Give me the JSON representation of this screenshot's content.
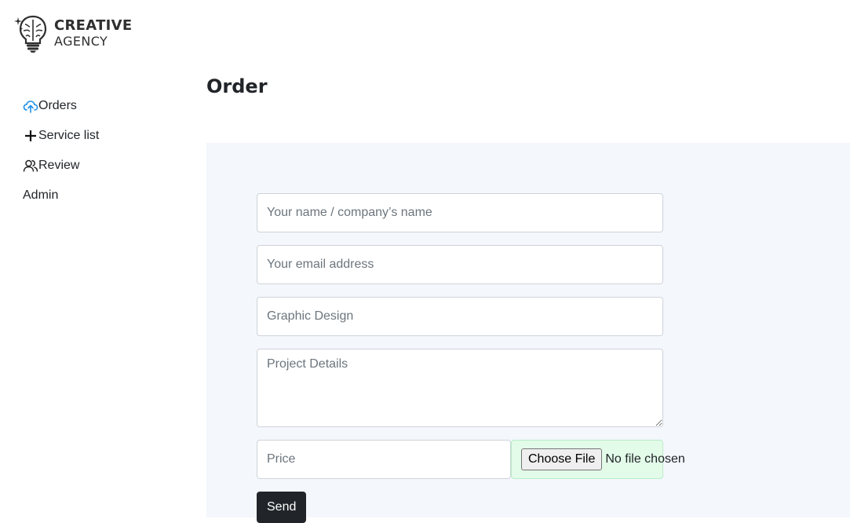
{
  "brand": {
    "line1": "CREATIVE",
    "line2": "AGENCY"
  },
  "sidebar": {
    "items": [
      {
        "label": "Orders",
        "icon": "cloud-upload-icon"
      },
      {
        "label": "Service list",
        "icon": "plus-icon"
      },
      {
        "label": "Review",
        "icon": "users-icon"
      },
      {
        "label": "Admin",
        "icon": ""
      }
    ]
  },
  "page": {
    "title": "Order"
  },
  "form": {
    "name_placeholder": "Your name / company’s name",
    "email_placeholder": "Your email address",
    "service_placeholder": "Graphic Design",
    "details_placeholder": "Project Details",
    "price_placeholder": "Price",
    "file_button_label": "Choose File",
    "file_status": "No file chosen",
    "submit_label": "Send"
  },
  "colors": {
    "panel_bg": "#f4f7fc",
    "file_box_bg": "#e3fbe9",
    "send_button_bg": "#212529",
    "orders_icon": "#1d8fe8"
  }
}
